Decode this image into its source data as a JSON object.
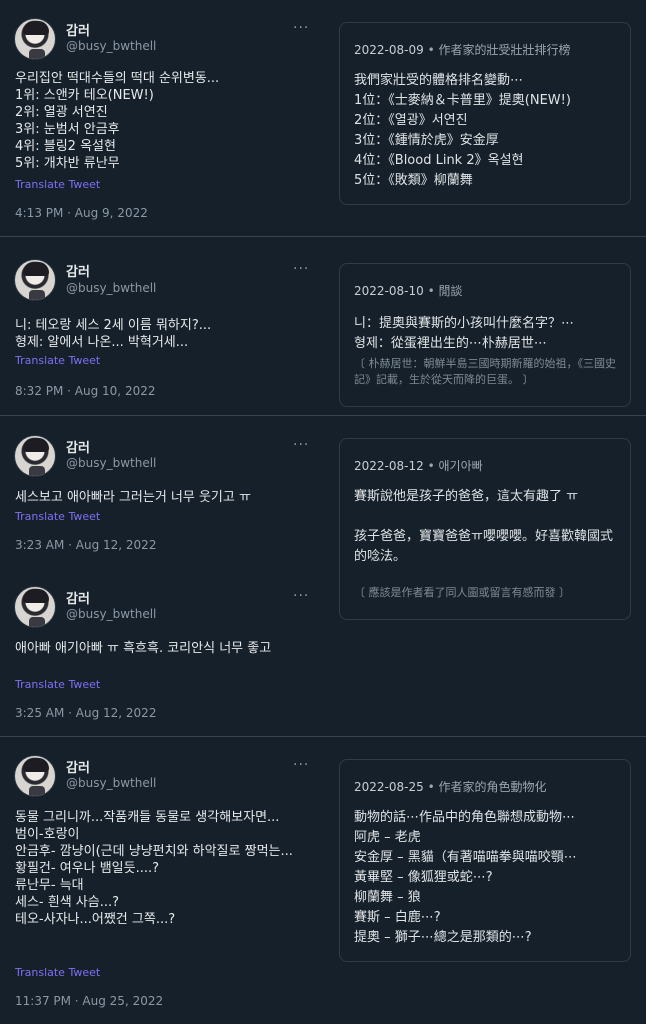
{
  "sections": [
    {
      "tweets": [
        {
          "name": "감러",
          "handle": "@busy_bwthell",
          "text": "우리집안 떡대수들의 떡대 순위변동...\n1위: 스앤카 테오(NEW!)\n2위: 열광 서연진\n3위: 눈범서 안금후\n4위: 블링2 옥설현\n5위: 개차반 류난무",
          "translate": "Translate Tweet",
          "timestamp": "4:13 PM · Aug 9, 2022"
        }
      ],
      "card": {
        "date": "2022-08-09",
        "category": "作者家的壯受壯壯排行榜",
        "body": "我們家壯受的體格排名變動⋯\n1位：《士麥納＆卡普里》提奧(NEW!)\n2位：《열광》서연진\n3位：《鍾情於虎》安金厚\n4位：《Blood Link 2》옥설현\n5位：《敗類》柳蘭舞",
        "note": ""
      }
    },
    {
      "tweets": [
        {
          "name": "감러",
          "handle": "@busy_bwthell",
          "text": "니: 테오랑 세스 2세 이름 뭐하지?...\n형제: 알에서 나온... 박혁거세...",
          "translate": "Translate Tweet",
          "timestamp": "8:32 PM · Aug 10, 2022"
        }
      ],
      "card": {
        "date": "2022-08-10",
        "category": "閒談",
        "body": "니：提奧與賽斯的小孩叫什麼名字？⋯\n형제：從蛋裡出生的⋯朴赫居世⋯",
        "note": "〔 朴赫居世：朝鮮半島三國時期新羅的始祖，《三國史記》記載，生於從天而降的巨蛋。 〕"
      }
    },
    {
      "tweets": [
        {
          "name": "감러",
          "handle": "@busy_bwthell",
          "text": "세스보고 애아빠라 그러는거 너무 웃기고 ㅠ",
          "translate": "Translate Tweet",
          "timestamp": "3:23 AM · Aug 12, 2022"
        },
        {
          "name": "감러",
          "handle": "@busy_bwthell",
          "text": "애아빠 애기아빠 ㅠ 흑흐흑. 코리안식 너무 좋고",
          "translate": "Translate Tweet",
          "timestamp": "3:25 AM · Aug 12, 2022"
        }
      ],
      "card": {
        "date": "2022-08-12",
        "category": "애기아빠",
        "body": "賽斯說他是孩子的爸爸，這太有趣了 ㅠ\n\n孩子爸爸，寶寶爸爸ㅠ嚶嚶嚶。好喜歡韓國式的唸法。",
        "note": "〔 應該是作者看了同人圖或留言有感而發 〕"
      }
    },
    {
      "tweets": [
        {
          "name": "감러",
          "handle": "@busy_bwthell",
          "text": "동물 그리니까...작품캐들 동물로 생각해보자면...\n범이-호랑이\n안금후- 깜냥이(근데 냥냥펀치와 하악질로 짱먹는...\n황필건- 여우나 뱀일듯....?\n류난무- 늑대\n세스- 흰색 사슴...?\n테오-사자나...어쨌건 그쪽...?",
          "translate": "Translate Tweet",
          "timestamp": "11:37 PM · Aug 25, 2022"
        }
      ],
      "card": {
        "date": "2022-08-25",
        "category": "作者家的角色動物化",
        "body": "動物的話⋯作品中的角色聯想成動物⋯\n阿虎 – 老虎\n安金厚 – 黑貓（有著喵喵拳與喵咬顎⋯\n黃畢堅 – 像狐狸或蛇⋯?\n柳蘭舞 – 狼\n賽斯 – 白鹿⋯?\n提奧 – 獅子⋯總之是那類的⋯?",
        "note": ""
      }
    }
  ],
  "ui": {
    "more_icon": "···",
    "separator": "•"
  }
}
